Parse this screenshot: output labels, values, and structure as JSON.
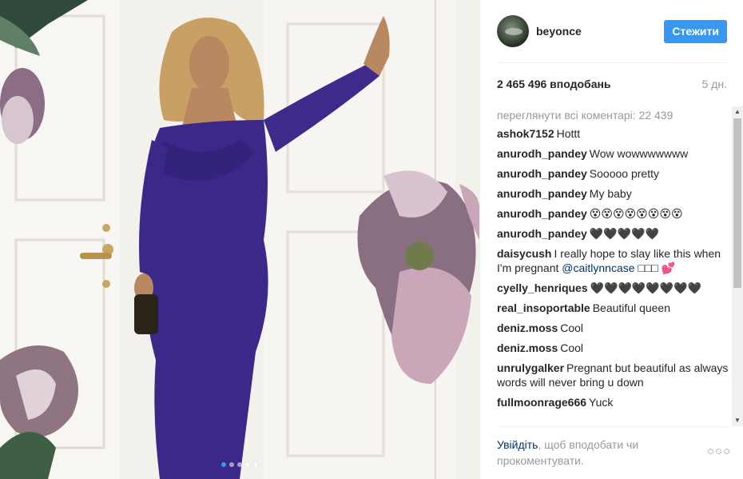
{
  "post": {
    "username": "beyonce",
    "follow_label": "Стежити",
    "likes": "2 465 496 вподобань",
    "age": "5 дн.",
    "view_all_comments": "переглянути всі коментарі: 22 439",
    "carousel": {
      "count": 5,
      "active": 0
    }
  },
  "comments": [
    {
      "author": "ashok7152",
      "text": "Hottt"
    },
    {
      "author": "anurodh_pandey",
      "text": "Wow wowwwwwww"
    },
    {
      "author": "anurodh_pandey",
      "text": "Sooooo pretty"
    },
    {
      "author": "anurodh_pandey",
      "text": "My baby"
    },
    {
      "author": "anurodh_pandey",
      "text": "😵😵😵😵😵😵😵😵"
    },
    {
      "author": "anurodh_pandey",
      "text": "🖤🖤🖤🖤🖤"
    },
    {
      "author": "daisycush",
      "text": "I really hope to slay like this when I'm pregnant",
      "mention": "@caitlynncase",
      "text_after": " □□□ 💕"
    },
    {
      "author": "cyelly_henriques",
      "text": "🖤🖤🖤🖤🖤🖤🖤🖤"
    },
    {
      "author": "real_insoportable",
      "text": "Beautiful queen"
    },
    {
      "author": "deniz.moss",
      "text": "Cool"
    },
    {
      "author": "deniz.moss",
      "text": "Cool"
    },
    {
      "author": "unrulygalker",
      "text": "Pregnant but beautiful as always words will never bring u down"
    },
    {
      "author": "fullmoonrage666",
      "text": "Yuck"
    }
  ],
  "footer": {
    "login_link": "Увійдіть",
    "login_rest": ", щоб вподобати чи прокоментувати.",
    "more_icon": "more-options-icon"
  },
  "scrollbar": {
    "up_glyph": "▲",
    "down_glyph": "▼"
  }
}
